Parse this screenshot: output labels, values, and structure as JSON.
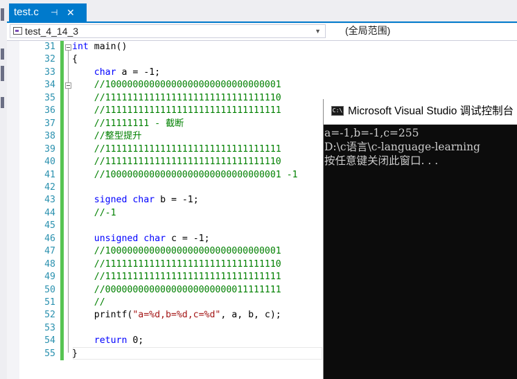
{
  "tab": {
    "filename": "test.c",
    "pin_glyph": "⊣",
    "close_glyph": "✕"
  },
  "navbar": {
    "project": "test_4_14_3",
    "scope": "(全局范围)"
  },
  "editor": {
    "lines": [
      {
        "n": "31",
        "parts": [
          [
            "kw",
            "int"
          ],
          [
            "fn",
            " main()"
          ]
        ]
      },
      {
        "n": "32",
        "parts": [
          [
            "fn",
            "{"
          ]
        ]
      },
      {
        "n": "33",
        "parts": [
          [
            "fn",
            "    "
          ],
          [
            "kw",
            "char"
          ],
          [
            "fn",
            " a = -1;"
          ]
        ]
      },
      {
        "n": "34",
        "parts": [
          [
            "fn",
            "    "
          ],
          [
            "cm",
            "//10000000000000000000000000000001"
          ]
        ]
      },
      {
        "n": "35",
        "parts": [
          [
            "fn",
            "    "
          ],
          [
            "cm",
            "//11111111111111111111111111111110"
          ]
        ]
      },
      {
        "n": "36",
        "parts": [
          [
            "fn",
            "    "
          ],
          [
            "cm",
            "//11111111111111111111111111111111"
          ]
        ]
      },
      {
        "n": "37",
        "parts": [
          [
            "fn",
            "    "
          ],
          [
            "cm",
            "//11111111 - 截断"
          ]
        ]
      },
      {
        "n": "38",
        "parts": [
          [
            "fn",
            "    "
          ],
          [
            "cm",
            "//整型提升"
          ]
        ]
      },
      {
        "n": "39",
        "parts": [
          [
            "fn",
            "    "
          ],
          [
            "cm",
            "//11111111111111111111111111111111"
          ]
        ]
      },
      {
        "n": "40",
        "parts": [
          [
            "fn",
            "    "
          ],
          [
            "cm",
            "//11111111111111111111111111111110"
          ]
        ]
      },
      {
        "n": "41",
        "parts": [
          [
            "fn",
            "    "
          ],
          [
            "cm",
            "//10000000000000000000000000000001 -1"
          ]
        ]
      },
      {
        "n": "42",
        "parts": []
      },
      {
        "n": "43",
        "parts": [
          [
            "fn",
            "    "
          ],
          [
            "kw",
            "signed"
          ],
          [
            "fn",
            " "
          ],
          [
            "kw",
            "char"
          ],
          [
            "fn",
            " b = -1;"
          ]
        ]
      },
      {
        "n": "44",
        "parts": [
          [
            "fn",
            "    "
          ],
          [
            "cm",
            "//-1"
          ]
        ]
      },
      {
        "n": "45",
        "parts": []
      },
      {
        "n": "46",
        "parts": [
          [
            "fn",
            "    "
          ],
          [
            "kw",
            "unsigned"
          ],
          [
            "fn",
            " "
          ],
          [
            "kw",
            "char"
          ],
          [
            "fn",
            " c = -1;"
          ]
        ]
      },
      {
        "n": "47",
        "parts": [
          [
            "fn",
            "    "
          ],
          [
            "cm",
            "//10000000000000000000000000000001"
          ]
        ]
      },
      {
        "n": "48",
        "parts": [
          [
            "fn",
            "    "
          ],
          [
            "cm",
            "//11111111111111111111111111111110"
          ]
        ]
      },
      {
        "n": "49",
        "parts": [
          [
            "fn",
            "    "
          ],
          [
            "cm",
            "//11111111111111111111111111111111"
          ]
        ]
      },
      {
        "n": "50",
        "parts": [
          [
            "fn",
            "    "
          ],
          [
            "cm",
            "//00000000000000000000000011111111"
          ]
        ]
      },
      {
        "n": "51",
        "parts": [
          [
            "fn",
            "    "
          ],
          [
            "cm",
            "//"
          ]
        ]
      },
      {
        "n": "52",
        "parts": [
          [
            "fn",
            "    printf("
          ],
          [
            "str",
            "\"a=%d,b=%d,c=%d\""
          ],
          [
            "fn",
            ", a, b, c);"
          ]
        ]
      },
      {
        "n": "53",
        "parts": []
      },
      {
        "n": "54",
        "parts": [
          [
            "fn",
            "    "
          ],
          [
            "kw",
            "return"
          ],
          [
            "fn",
            " 0;"
          ]
        ]
      },
      {
        "n": "55",
        "parts": [
          [
            "fn",
            "}"
          ]
        ]
      }
    ]
  },
  "console": {
    "icon_text": "C:\\",
    "title": "Microsoft Visual Studio 调试控制台",
    "lines": [
      "a=-1,b=-1,c=255",
      "D:\\c语言\\c-language-learning",
      "按任意键关闭此窗口. . ."
    ]
  }
}
